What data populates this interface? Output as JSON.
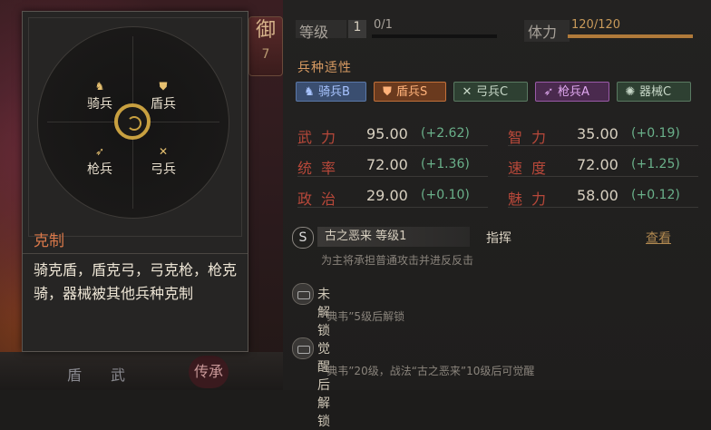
{
  "side_tab": {
    "char": "御",
    "number": "7"
  },
  "bottom_bar": {
    "items": [
      "盾",
      "武",
      "传承"
    ]
  },
  "header": {
    "level_label": "等级",
    "level_value": "1",
    "exp_text": "0/1",
    "stamina_label": "体力",
    "stamina_text": "120/120"
  },
  "affinity": {
    "title": "兵种适性",
    "chips": [
      {
        "icon": "cavalry-icon",
        "label": "骑兵B"
      },
      {
        "icon": "shield-icon",
        "label": "盾兵S"
      },
      {
        "icon": "bow-icon",
        "label": "弓兵C"
      },
      {
        "icon": "spear-icon",
        "label": "枪兵A"
      },
      {
        "icon": "siege-icon",
        "label": "器械C"
      }
    ]
  },
  "stats": [
    {
      "name": "武力",
      "value": "95.00",
      "bonus": "(+2.62)"
    },
    {
      "name": "智力",
      "value": "35.00",
      "bonus": "(+0.19)"
    },
    {
      "name": "统率",
      "value": "72.00",
      "bonus": "(+1.36)"
    },
    {
      "name": "速度",
      "value": "72.00",
      "bonus": "(+1.25)"
    },
    {
      "name": "政治",
      "value": "29.00",
      "bonus": "(+0.10)"
    },
    {
      "name": "魅力",
      "value": "58.00",
      "bonus": "(+0.12)"
    }
  ],
  "skill": {
    "badge": "S",
    "name": "古之恶来 等级1",
    "tag": "指挥",
    "view": "查看",
    "desc": "为主将承担普通攻击并进反反击"
  },
  "locks": [
    {
      "title": "未解锁",
      "desc": "“典韦”5级后解锁"
    },
    {
      "title": "觉醒后解锁",
      "desc": "“典韦”20级，战法“古之恶来”10级后可觉醒"
    }
  ],
  "popup": {
    "units": [
      {
        "icon": "cavalry-icon",
        "label": "骑兵"
      },
      {
        "icon": "shield-icon",
        "label": "盾兵"
      },
      {
        "icon": "spear-icon",
        "label": "枪兵"
      },
      {
        "icon": "bow-icon",
        "label": "弓兵"
      }
    ],
    "title": "克制",
    "body": "骑克盾，盾克弓，弓克枪，枪克骑，器械被其他兵种克制"
  },
  "colors": {
    "accent_orange": "#d8784a",
    "stat_name_red": "#b8483a",
    "bonus_green": "#6ab08a",
    "stamina_gold": "#c89a5a"
  }
}
